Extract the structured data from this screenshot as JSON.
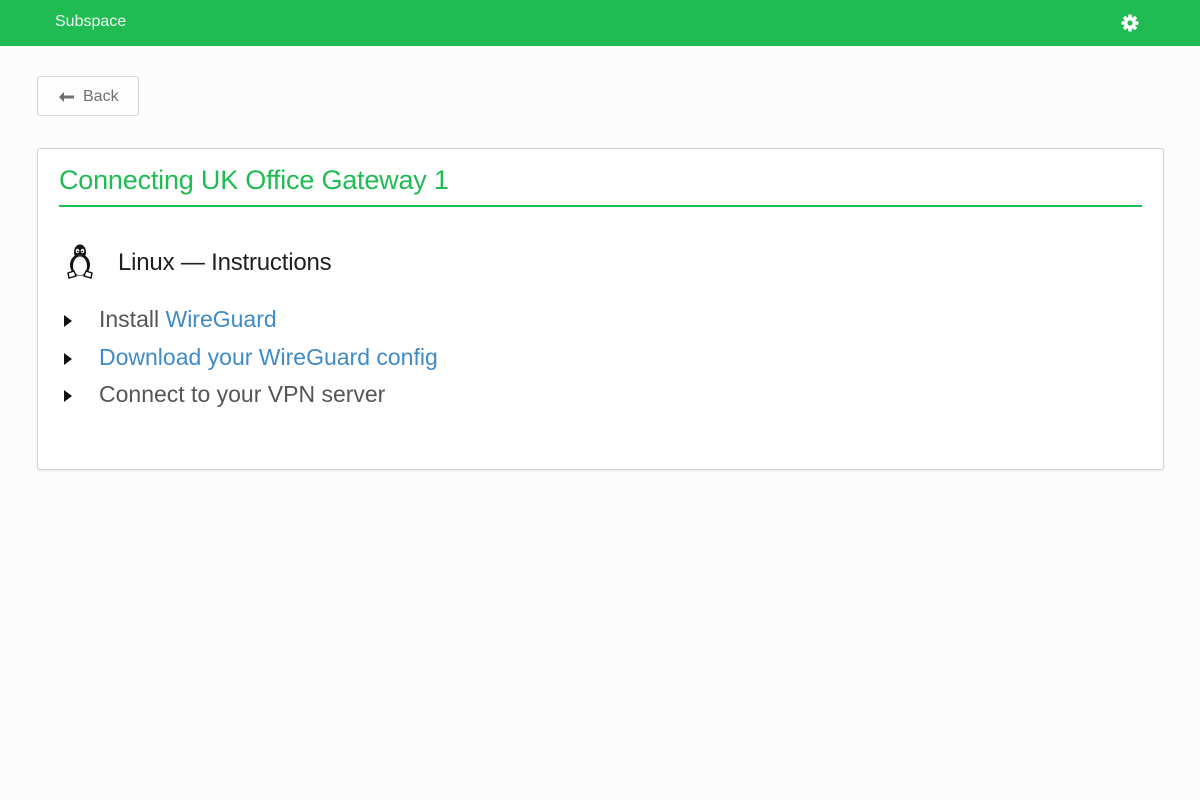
{
  "header": {
    "brand": "Subspace",
    "settings_icon": "gear-icon",
    "background_color": "#21bb53"
  },
  "back_button": {
    "label": "Back",
    "icon": "arrow-left-icon"
  },
  "card": {
    "title": "Connecting UK Office Gateway 1",
    "section": {
      "icon": "linux-icon",
      "title": "Linux — Instructions"
    },
    "steps": [
      {
        "prefix": "Install ",
        "link": "WireGuard"
      },
      {
        "prefix": "",
        "link": "Download your WireGuard config"
      },
      {
        "prefix": "Connect to your VPN server",
        "link": ""
      }
    ]
  },
  "colors": {
    "accent": "#21bb53",
    "link": "#3f8ac8",
    "text": "#555555"
  }
}
